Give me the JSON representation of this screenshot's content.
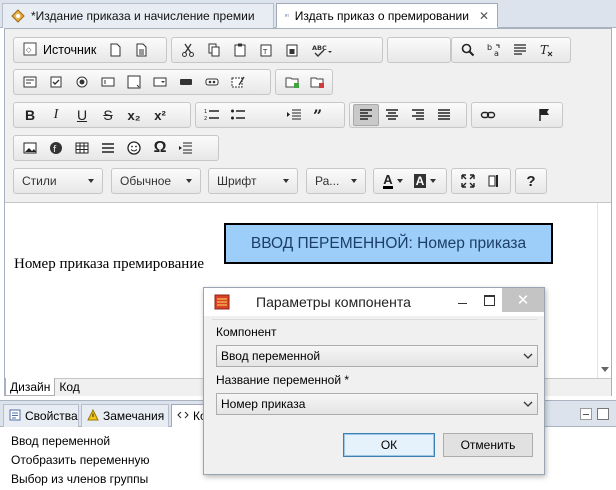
{
  "tabs": [
    {
      "label": "*Издание приказа и начисление премии",
      "icon": "gear-diamond-icon",
      "active": false
    },
    {
      "label": "Издать приказ о премировании",
      "icon": "html-page-icon",
      "active": true
    }
  ],
  "toolbar": {
    "source_label": "Источник",
    "combos": {
      "styles": "Стили",
      "format": "Обычное",
      "font": "Шрифт",
      "size": "Ра..."
    },
    "text_buttons": {
      "bold": "B",
      "italic": "I",
      "underline": "U",
      "strike": "S",
      "subscript": "x₂",
      "superscript": "x²",
      "help": "?",
      "omega": "Ω"
    },
    "font_color_letter": "A"
  },
  "content": {
    "text": "Номер приказа премирование",
    "variable_box": "ВВОД ПЕРЕМЕННОЙ: Номер приказа"
  },
  "bottom_tabs": [
    "Дизайн",
    "Код"
  ],
  "views": {
    "tabs": [
      "Свойства",
      "Замечания",
      "Ко"
    ],
    "items": [
      "Ввод переменной",
      "Отобразить переменную",
      "Выбор из членов группы"
    ]
  },
  "dialog": {
    "title": "Параметры компонента",
    "component_label": "Компонент",
    "component_value": "Ввод переменной",
    "varname_label": "Название переменной *",
    "varname_value": "Номер приказа",
    "ok": "ОК",
    "cancel": "Отменить",
    "close": "✕"
  },
  "colors": {
    "variable_fill": "#9dcdf9",
    "ok_border": "#3c7fb1",
    "tabbar": "#dde3ec"
  }
}
